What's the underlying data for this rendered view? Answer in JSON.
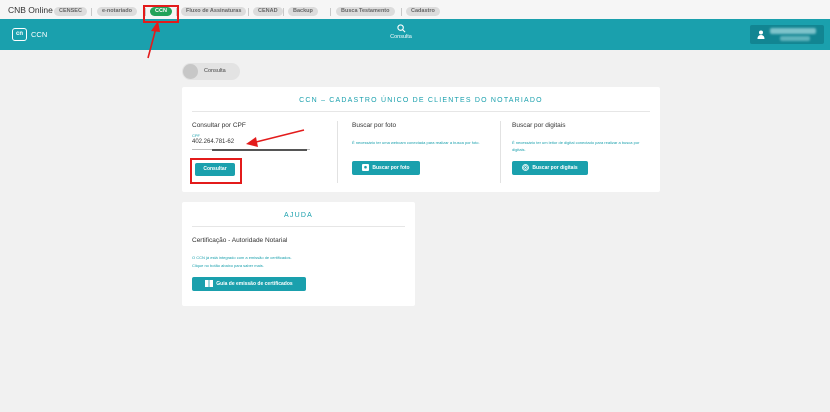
{
  "topbar": {
    "brand": "CNB Online",
    "items": [
      "CENSEC",
      "e-notariado",
      "CCN",
      "Fluxo de Assinaturas",
      "CENAD",
      "Backup",
      "Busca Testamento",
      "Cadastro"
    ],
    "active_item": "CCN"
  },
  "header": {
    "logo_text": "CCN",
    "nav_label": "Consulta",
    "user_name_blurred": "",
    "user_sub_blurred": ""
  },
  "breadcrumb": {
    "label": "Consulta"
  },
  "main_card": {
    "title": "CCN – CADASTRO ÚNICO DE CLIENTES DO NOTARIADO",
    "cpf": {
      "heading": "Consultar por CPF",
      "field_label": "CPF",
      "field_value": "402.264.781-62",
      "button": "Consultar"
    },
    "photo": {
      "heading": "Buscar por foto",
      "note": "É necessário ter uma webcam conectada para realizar a busca por foto.",
      "button": "Buscar por foto"
    },
    "digital": {
      "heading": "Buscar por digitais",
      "note": "É necessário ter um leitor de digital conectado para realizar a busca por digitais.",
      "button": "Buscar por digitais"
    }
  },
  "help_card": {
    "title": "AJUDA",
    "heading": "Certificação - Autoridade Notarial",
    "line1": "O CCN já está integrado com a emissão de certificados.",
    "line2": "Clique no botão abaixo para saber mais.",
    "button": "Guia de emissão de certificados"
  },
  "colors": {
    "accent": "#1aa0ad",
    "annotation": "#e31b1b",
    "active_pill": "#22a35a"
  },
  "icons": [
    "search-icon",
    "user-icon",
    "camera-icon",
    "fingerprint-icon",
    "book-icon"
  ]
}
